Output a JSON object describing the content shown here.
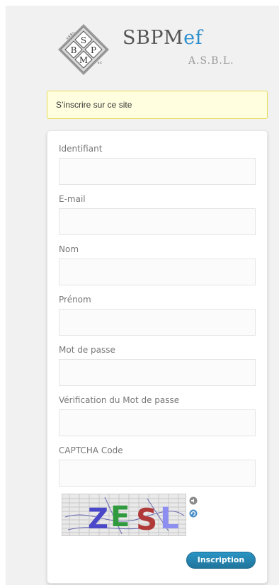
{
  "logo": {
    "title_main": "SBPM",
    "title_accent": "ef",
    "subtitle": "A.S.B.L.",
    "diamond_letters": [
      "S",
      "B",
      "P",
      "M"
    ],
    "tiny_text_left": "A.S.B.L.",
    "tiny_text_right": "e.f."
  },
  "notice": {
    "text": "S’inscrire sur ce site"
  },
  "form": {
    "fields": [
      {
        "label": "Identifiant",
        "value": ""
      },
      {
        "label": "E-mail",
        "value": ""
      },
      {
        "label": "Nom",
        "value": ""
      },
      {
        "label": "Prénom",
        "value": ""
      },
      {
        "label": "Mot de passe",
        "value": ""
      },
      {
        "label": "Vérification du Mot de passe",
        "value": ""
      },
      {
        "label": "CAPTCHA Code",
        "value": ""
      }
    ],
    "captcha": {
      "letters": [
        "Z",
        "E",
        "S",
        "L"
      ],
      "colors": [
        "#4a48c8",
        "#2f9a3e",
        "#b03a3a",
        "#8e8ef0"
      ]
    },
    "captcha_icons": [
      "speaker-icon",
      "refresh-icon"
    ],
    "submit_label": "Inscription"
  },
  "colors": {
    "accent": "#21759b",
    "notice_bg": "#ffffe0",
    "notice_border": "#e6db55",
    "logo_accent": "#2e8fcc"
  }
}
